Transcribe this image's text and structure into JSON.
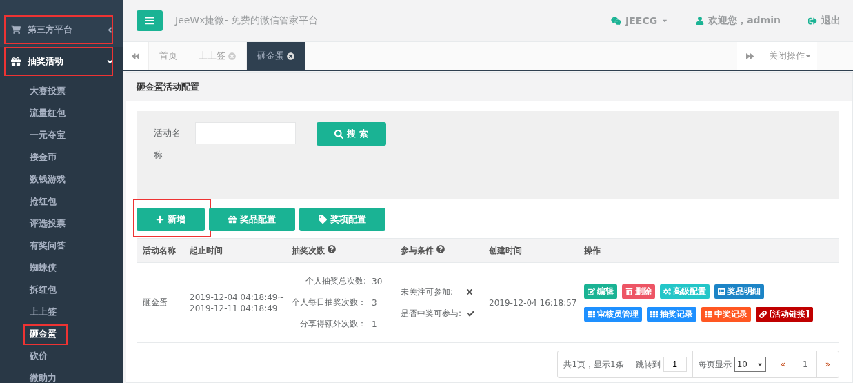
{
  "sidebar": {
    "items": [
      {
        "label": "第三方平台",
        "kind": "cart",
        "expanded": false,
        "highlighted": true
      },
      {
        "label": "抽奖活动",
        "kind": "gift",
        "expanded": true,
        "highlighted": true,
        "children": [
          {
            "label": "大赛投票",
            "selected": false,
            "highlighted": false
          },
          {
            "label": "流量红包",
            "selected": false,
            "highlighted": false
          },
          {
            "label": "一元夺宝",
            "selected": false,
            "highlighted": false
          },
          {
            "label": "接金币",
            "selected": false,
            "highlighted": false
          },
          {
            "label": "数钱游戏",
            "selected": false,
            "highlighted": false
          },
          {
            "label": "抢红包",
            "selected": false,
            "highlighted": false
          },
          {
            "label": "评选投票",
            "selected": false,
            "highlighted": false
          },
          {
            "label": "有奖问答",
            "selected": false,
            "highlighted": false
          },
          {
            "label": "蜘蛛侠",
            "selected": false,
            "highlighted": false
          },
          {
            "label": "拆红包",
            "selected": false,
            "highlighted": false
          },
          {
            "label": "上上签",
            "selected": false,
            "highlighted": false
          },
          {
            "label": "砸金蛋",
            "selected": true,
            "highlighted": true
          },
          {
            "label": "砍价",
            "selected": false,
            "highlighted": false
          },
          {
            "label": "微助力",
            "selected": false,
            "highlighted": false
          }
        ]
      }
    ]
  },
  "header": {
    "title": "JeeWx捷微- 免费的微信管家平台",
    "account": "JEECG",
    "welcome": "欢迎您，admin",
    "logout": "退出"
  },
  "tabs": [
    {
      "label": "首页",
      "closable": false,
      "selected": false
    },
    {
      "label": "上上签",
      "closable": true,
      "selected": false
    },
    {
      "label": "砸金蛋",
      "closable": true,
      "selected": true
    }
  ],
  "close_menu": "关闭操作",
  "panel": {
    "title": "砸金蛋活动配置",
    "search": {
      "label": "活动名称",
      "button": "搜 索"
    },
    "toolbar": [
      {
        "label": "新增",
        "kind": "add",
        "highlighted": true
      },
      {
        "label": "奖品配置",
        "kind": "gift",
        "highlighted": false
      },
      {
        "label": "奖项配置",
        "kind": "tag",
        "highlighted": false
      }
    ],
    "table": {
      "columns": [
        {
          "label": "活动名称",
          "help": false
        },
        {
          "label": "起止时间",
          "help": false
        },
        {
          "label": "抽奖次数",
          "help": true
        },
        {
          "label": "参与条件",
          "help": true
        },
        {
          "label": "创建时间",
          "help": false
        },
        {
          "label": "操作",
          "help": false
        }
      ],
      "rows": [
        {
          "name": "砸金蛋",
          "period": [
            "2019-12-04 04:18:49~",
            "2019-12-11 04:18:49"
          ],
          "counts": [
            {
              "label": "个人抽奖总次数:",
              "value": "30"
            },
            {
              "label": "个人每日抽奖次数：",
              "value": "3"
            },
            {
              "label": "分享得额外次数：",
              "value": "1"
            }
          ],
          "conditions": [
            {
              "label": "未关注可参加:",
              "allowed": false
            },
            {
              "label": "是否中奖可参与:",
              "allowed": true
            }
          ],
          "created": "2019-12-04 16:18:57",
          "actions": [
            [
              {
                "label": "编辑",
                "kind": "edit",
                "color": "#1ab394"
              },
              {
                "label": "删除",
                "kind": "delete",
                "color": "#ed5565"
              },
              {
                "label": "高级配置",
                "kind": "config",
                "color": "#23c6c8"
              },
              {
                "label": "奖品明细",
                "kind": "detail",
                "color": "#1c84c6"
              }
            ],
            [
              {
                "label": "审核员管理",
                "kind": "list",
                "color": "#1e90ff"
              },
              {
                "label": "抽奖记录",
                "kind": "list",
                "color": "#1e90ff"
              },
              {
                "label": "中奖记录",
                "kind": "list",
                "color": "#ff5722"
              },
              {
                "label": "[活动链接]",
                "kind": "link",
                "color": "#c00000"
              }
            ]
          ]
        }
      ]
    },
    "pagination": {
      "summary": "共1页，显示1条",
      "jump_label": "跳转到",
      "jump_value": "1",
      "size_label": "每页显示",
      "size_value": "10",
      "prev": "«",
      "pages": [
        {
          "label": "1",
          "selected": true
        }
      ],
      "next": "»"
    }
  }
}
